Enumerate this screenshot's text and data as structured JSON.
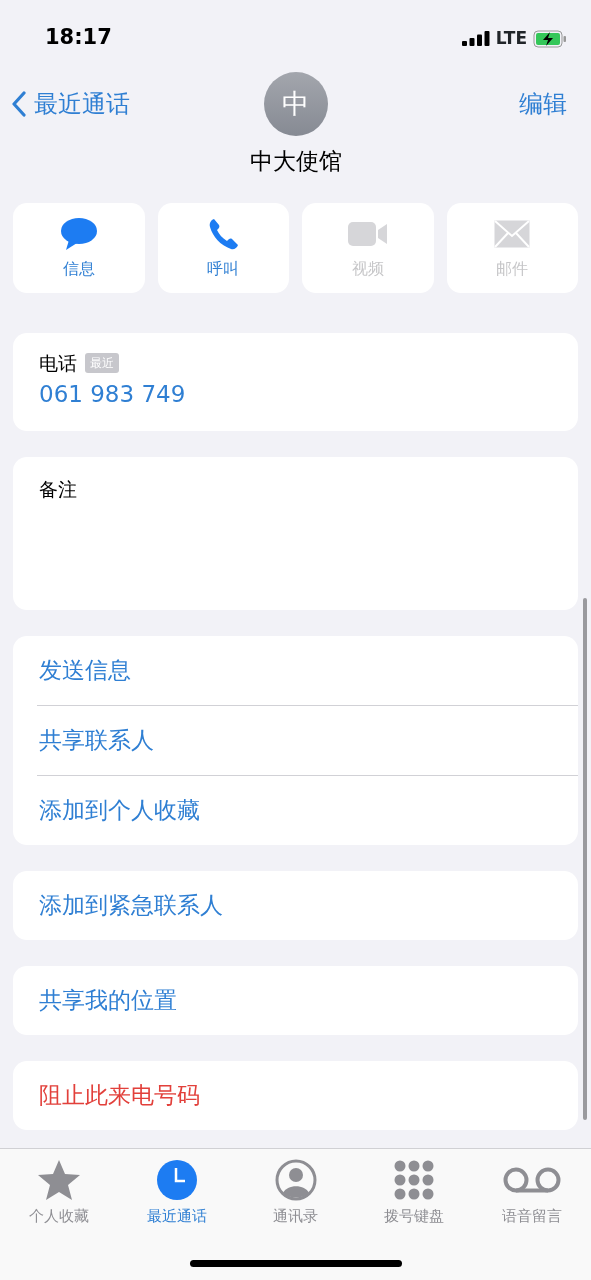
{
  "status_bar": {
    "time": "18:17",
    "network": "LTE"
  },
  "nav": {
    "back_label": "最近通话",
    "edit_label": "编辑"
  },
  "contact": {
    "initial": "中",
    "name": "中大使馆"
  },
  "actions": [
    {
      "kind": "message",
      "label": "信息",
      "disabled": false
    },
    {
      "kind": "call",
      "label": "呼叫",
      "disabled": false
    },
    {
      "kind": "video",
      "label": "视频",
      "disabled": true
    },
    {
      "kind": "mail",
      "label": "邮件",
      "disabled": true
    }
  ],
  "phone": {
    "label": "电话",
    "badge": "最近",
    "number": "061 983 749"
  },
  "notes": {
    "label": "备注"
  },
  "groups": [
    [
      {
        "label": "发送信息",
        "kind": "link"
      },
      {
        "label": "共享联系人",
        "kind": "link"
      },
      {
        "label": "添加到个人收藏",
        "kind": "link"
      }
    ],
    [
      {
        "label": "添加到紧急联系人",
        "kind": "link"
      }
    ],
    [
      {
        "label": "共享我的位置",
        "kind": "link"
      }
    ],
    [
      {
        "label": "阻止此来电号码",
        "kind": "destructive"
      }
    ]
  ],
  "tab_bar": [
    {
      "kind": "favorites",
      "label": "个人收藏",
      "selected": false
    },
    {
      "kind": "recents",
      "label": "最近通话",
      "selected": true
    },
    {
      "kind": "contacts",
      "label": "通讯录",
      "selected": false
    },
    {
      "kind": "keypad",
      "label": "拨号键盘",
      "selected": false
    },
    {
      "kind": "voicemail",
      "label": "语音留言",
      "selected": false
    }
  ]
}
